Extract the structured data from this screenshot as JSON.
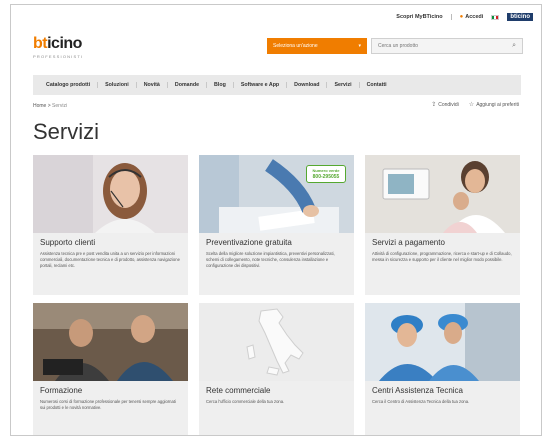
{
  "toplinks": {
    "scopri": "Scopri MyBTicino",
    "accedi": "Accedi",
    "mini_logo": "bticino"
  },
  "logo": {
    "brand_b": "bt",
    "brand_rest": "icino",
    "tagline": "PROFESSIONISTI"
  },
  "header": {
    "select_label": "Seleziona un'azione",
    "search_placeholder": "Cerca un prodotto"
  },
  "nav": [
    "Catalogo prodotti",
    "Soluzioni",
    "Novità",
    "Domande",
    "Blog",
    "Software e App",
    "Download",
    "Servizi",
    "Contatti"
  ],
  "breadcrumb": {
    "home": "Home",
    "current": "Servizi"
  },
  "actions": {
    "share": "Condividi",
    "favorites": "Aggiungi ai preferiti"
  },
  "page_title": "Servizi",
  "cards": [
    {
      "title": "Supporto clienti",
      "desc": "Assistenza tecnica pre e post vendita unita a un servizio per informazioni commerciali, documentazione tecnica e di prodotto, assistenza navigazione portali, reclami etc."
    },
    {
      "title": "Preventivazione gratuita",
      "desc": "Scelta della migliore soluzione impiantistica, preventivi personalizzati, schemi di collegamento, note tecniche, consulenza installazione e configurazione dei dispositivi.",
      "badge_label": "Numero verde",
      "badge_number": "800-295055"
    },
    {
      "title": "Servizi a pagamento",
      "desc": "Attività di configurazione, programmazione, ricerca e start-up e di Collaudo, messa in sicurezza e supporto per il cliente nel miglior modo possibile."
    },
    {
      "title": "Formazione",
      "desc": "Numerosi corsi di formazione professionale per tenersi sempre aggiornati sui prodotti e le novità normative."
    },
    {
      "title": "Rete commerciale",
      "desc": "Cerca l'ufficio commerciale della tua zona."
    },
    {
      "title": "Centri Assistenza Tecnica",
      "desc": "Cerca il Centro di Assistenza Tecnica della tua zona."
    }
  ],
  "colors": {
    "brand_orange": "#f07d00",
    "nav_bg": "#e9e9e9",
    "card_bg": "#efefef",
    "badge_green": "#55a830"
  }
}
